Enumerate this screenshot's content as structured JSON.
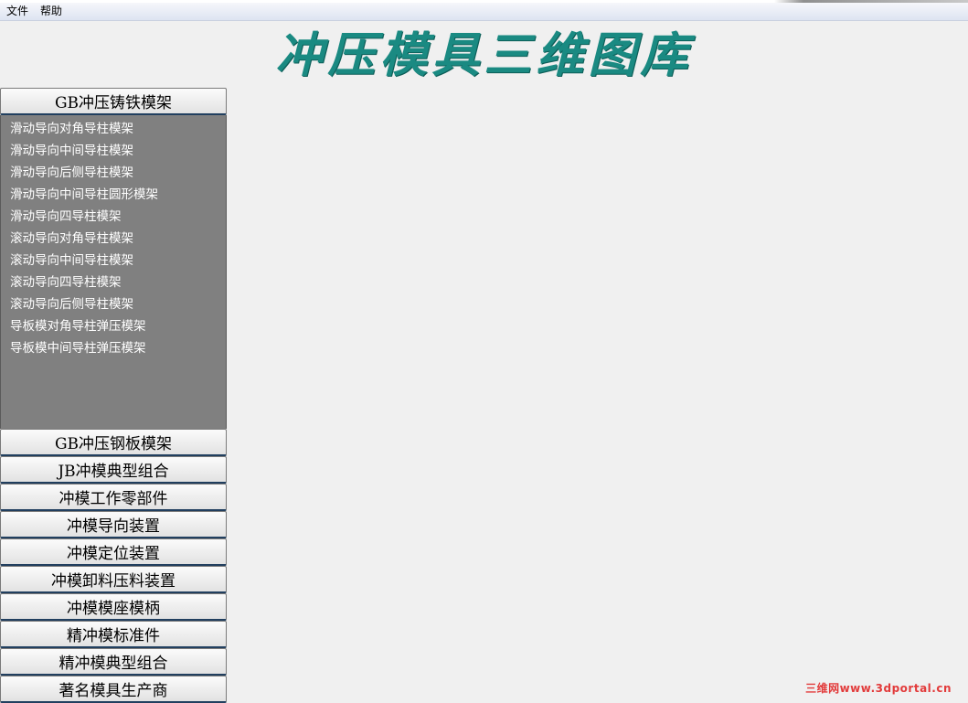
{
  "menubar": {
    "items": [
      "文件",
      "帮助"
    ]
  },
  "title": "冲压模具三维图库",
  "sidebar": {
    "expanded": {
      "label": "GB冲压铸铁模架",
      "items": [
        "滑动导向对角导柱模架",
        "滑动导向中间导柱模架",
        "滑动导向后侧导柱模架",
        "滑动导向中间导柱圆形模架",
        "滑动导向四导柱模架",
        "滚动导向对角导柱模架",
        "滚动导向中间导柱模架",
        "滚动导向四导柱模架",
        "滚动导向后侧导柱模架",
        "导板模对角导柱弹压模架",
        "导板模中间导柱弹压模架"
      ]
    },
    "categories": [
      "GB冲压钢板模架",
      "JB冲模典型组合",
      "冲模工作零部件",
      "冲模导向装置",
      "冲模定位装置",
      "冲模卸料压料装置",
      "冲模模座模柄",
      "精冲模标准件",
      "精冲模典型组合",
      "著名模具生产商"
    ]
  },
  "watermark": "三维网www.3dportal.cn"
}
